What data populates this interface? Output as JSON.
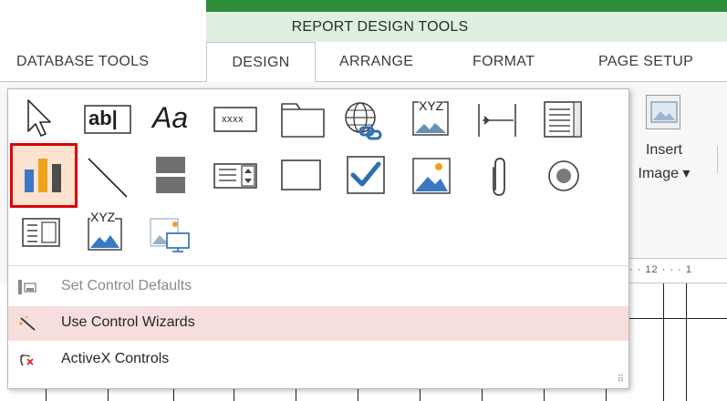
{
  "ribbon": {
    "context_title": "REPORT DESIGN TOOLS",
    "tabs": [
      {
        "label": "DATABASE TOOLS",
        "active": false
      },
      {
        "label": "DESIGN",
        "active": true
      },
      {
        "label": "ARRANGE",
        "active": false
      },
      {
        "label": "FORMAT",
        "active": false
      },
      {
        "label": "PAGE SETUP",
        "active": false
      }
    ],
    "insert_image": {
      "label_line1": "Insert",
      "label_line2": "Image ▾"
    },
    "ruler_text": "· · 12 · · · 1"
  },
  "controls_gallery": {
    "rows": [
      [
        {
          "name": "select-pointer",
          "icon": "arrow-pointer-icon"
        },
        {
          "name": "text-box",
          "icon": "text-box-icon",
          "text": "ab|"
        },
        {
          "name": "label",
          "icon": "label-icon",
          "text": "Aa"
        },
        {
          "name": "button",
          "icon": "button-icon",
          "text": "xxxx"
        },
        {
          "name": "tab-control",
          "icon": "tab-control-icon"
        },
        {
          "name": "hyperlink",
          "icon": "globe-link-icon"
        },
        {
          "name": "web-browser-control",
          "icon": "web-browser-icon",
          "text": "XYZ"
        },
        {
          "name": "navigation-control",
          "icon": "navigation-icon"
        },
        {
          "name": "option-group",
          "icon": "option-group-icon"
        }
      ],
      [
        {
          "name": "chart",
          "icon": "chart-icon",
          "selected": true
        },
        {
          "name": "line",
          "icon": "line-icon"
        },
        {
          "name": "page-break",
          "icon": "page-break-icon"
        },
        {
          "name": "combo-box",
          "icon": "combo-box-icon"
        },
        {
          "name": "rectangle",
          "icon": "rectangle-icon"
        },
        {
          "name": "check-box",
          "icon": "check-box-icon"
        },
        {
          "name": "image",
          "icon": "image-icon"
        },
        {
          "name": "attachment",
          "icon": "paperclip-icon"
        },
        {
          "name": "option-button",
          "icon": "radio-icon"
        }
      ],
      [
        {
          "name": "list-box",
          "icon": "list-box-icon"
        },
        {
          "name": "bound-object-frame",
          "icon": "bound-frame-icon",
          "text": "XYZ"
        },
        {
          "name": "unbound-object-frame",
          "icon": "unbound-frame-icon"
        }
      ]
    ],
    "colors": {
      "highlight_border": "#e00000",
      "highlight_fill": "#fbe3cf",
      "wizard_hover": "#f6dede"
    }
  },
  "menu": {
    "items": [
      {
        "label": "Set Control Defaults",
        "icon": "control-defaults-icon",
        "enabled": false
      },
      {
        "label": "Use Control Wizards",
        "icon": "wand-icon",
        "enabled": true,
        "hover": true
      },
      {
        "label": "ActiveX Controls",
        "icon": "activex-icon",
        "enabled": true
      }
    ]
  }
}
